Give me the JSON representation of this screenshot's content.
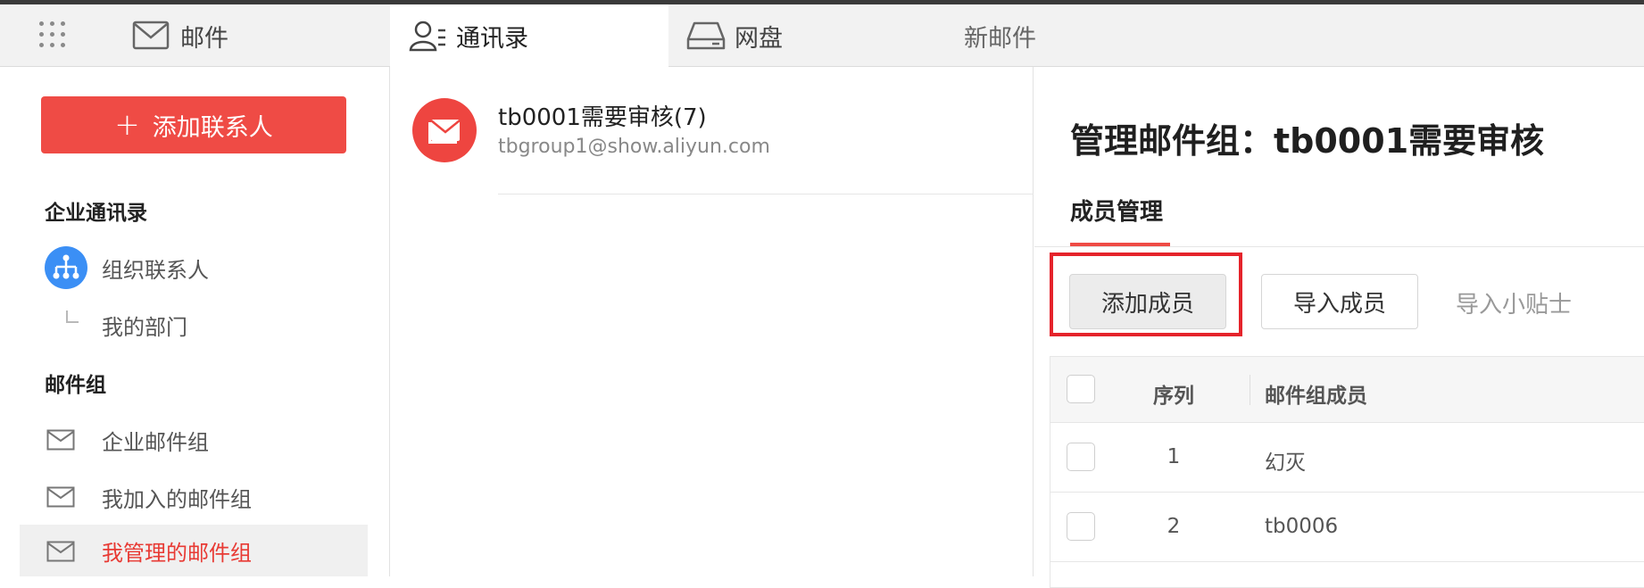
{
  "topnav": {
    "tabs": [
      {
        "label": "邮件",
        "icon": "envelope-icon"
      },
      {
        "label": "通讯录",
        "icon": "contacts-icon"
      },
      {
        "label": "网盘",
        "icon": "drive-icon"
      },
      {
        "label": "新邮件"
      }
    ],
    "active_tab": "通讯录"
  },
  "sidebar": {
    "add_contact_label": "添加联系人",
    "enterprise_section": "企业通讯录",
    "enterprise_items": [
      {
        "label": "组织联系人",
        "icon": "org-chart-icon"
      },
      {
        "label": "我的部门"
      }
    ],
    "groups_section": "邮件组",
    "group_items": [
      {
        "label": "企业邮件组",
        "icon": "mail-group-icon"
      },
      {
        "label": "我加入的邮件组",
        "icon": "mail-group-icon"
      },
      {
        "label": "我管理的邮件组",
        "icon": "mail-group-icon"
      }
    ],
    "active_item": "我管理的邮件组"
  },
  "group_list": [
    {
      "name": "tb0001需要审核(7)",
      "email": "tbgroup1@show.aliyun.com"
    }
  ],
  "detail": {
    "title": "管理邮件组：tb0001需要审核",
    "tab": "成员管理",
    "buttons": {
      "add_member": "添加成员",
      "import_member": "导入成员",
      "import_tips": "导入小贴士"
    },
    "table": {
      "headers": {
        "index": "序列",
        "member": "邮件组成员"
      },
      "rows": [
        {
          "index": "1",
          "member": "幻灭"
        },
        {
          "index": "2",
          "member": "tb0006"
        }
      ]
    }
  },
  "colors": {
    "accent": "#ef4b45",
    "highlight_box": "#e5232b",
    "org_icon": "#3b8ff5"
  }
}
